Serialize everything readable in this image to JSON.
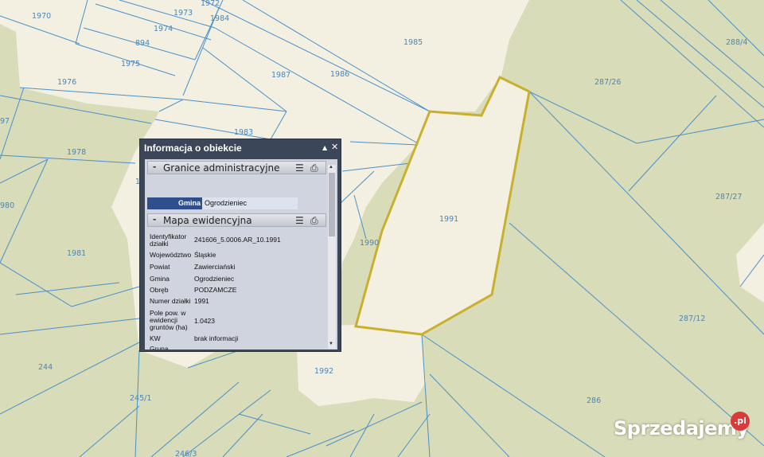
{
  "map": {
    "colors": {
      "background_land": "#d9dcb8",
      "built_area": "#f3f0e2",
      "parcel_line": "#4a90c8",
      "label": "#4a86b8",
      "highlight": "#c9b02c"
    },
    "highlighted_parcel": "1991",
    "parcels": [
      {
        "id": "1970",
        "label": "1970"
      },
      {
        "id": "1973",
        "label": "1973"
      },
      {
        "id": "1972",
        "label": "1972"
      },
      {
        "id": "1974",
        "label": "1974"
      },
      {
        "id": "1984",
        "label": "1984"
      },
      {
        "id": "894",
        "label": "894"
      },
      {
        "id": "1975",
        "label": "1975"
      },
      {
        "id": "1976",
        "label": "1976"
      },
      {
        "id": "1985",
        "label": "1985"
      },
      {
        "id": "1987",
        "label": "1987"
      },
      {
        "id": "1986",
        "label": "1986"
      },
      {
        "id": "288/4",
        "label": "288/4"
      },
      {
        "id": "287/26",
        "label": "287/26"
      },
      {
        "id": "97",
        "label": "97"
      },
      {
        "id": "1983",
        "label": "1983"
      },
      {
        "id": "1978",
        "label": "1978"
      },
      {
        "id": "287/27",
        "label": "287/27"
      },
      {
        "id": "1991",
        "label": "1991"
      },
      {
        "id": "980",
        "label": "980"
      },
      {
        "id": "1990",
        "label": "1990"
      },
      {
        "id": "1981",
        "label": "1981"
      },
      {
        "id": "287/12",
        "label": "287/12"
      },
      {
        "id": "1992",
        "label": "1992"
      },
      {
        "id": "244",
        "label": "244"
      },
      {
        "id": "245/1",
        "label": "245/1"
      },
      {
        "id": "286",
        "label": "286"
      },
      {
        "id": "246/3",
        "label": "246/3"
      },
      {
        "id": "1",
        "label": "1"
      }
    ]
  },
  "popup": {
    "title": "Informacja o obiekcie",
    "minimize_icon": "▲",
    "close_icon": "✕",
    "sections": {
      "admin": {
        "title": "Granice administracyjne"
      },
      "ewid": {
        "title": "Mapa ewidencyjna"
      }
    },
    "gmina": {
      "label": "Gmina",
      "value": "Ogrodzieniec"
    },
    "rows": [
      {
        "key": "Identyfikator działki",
        "value": "241606_5.0006.AR_10.1991"
      },
      {
        "key": "Województwo",
        "value": "Śląskie"
      },
      {
        "key": "Powiat",
        "value": "Zawierciański"
      },
      {
        "key": "Gmina",
        "value": "Ogrodzieniec"
      },
      {
        "key": "Obręb",
        "value": "PODZAMCZE"
      },
      {
        "key": "Numer działki",
        "value": "1991"
      },
      {
        "key": "Pole pow. w ewidencji gruntów (ha)",
        "value": "1.0423"
      },
      {
        "key": "KW",
        "value": "brak informacji"
      },
      {
        "key": "Grupa rejestrowa",
        "value": ""
      }
    ]
  },
  "watermark": {
    "text": "Sprzedajemy",
    "badge": ".pl"
  }
}
